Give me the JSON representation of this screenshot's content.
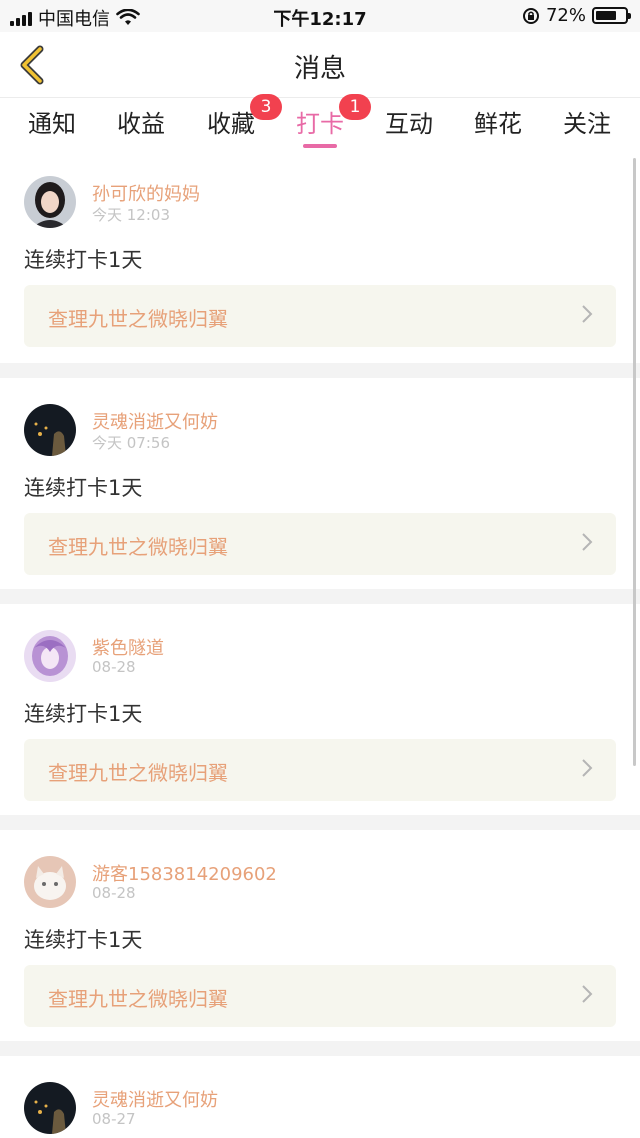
{
  "status_bar": {
    "carrier": "中国电信",
    "time": "下午12:17",
    "battery": "72%",
    "battery_level": 0.72,
    "icons": [
      "signal-icon",
      "wifi-icon",
      "rotation-lock-icon",
      "battery-icon"
    ]
  },
  "nav": {
    "title": "消息",
    "back_icon": "back-chevron-icon"
  },
  "tabs": [
    {
      "label": "通知",
      "active": false
    },
    {
      "label": "收益",
      "active": false
    },
    {
      "label": "收藏",
      "active": false,
      "badge": "3"
    },
    {
      "label": "打卡",
      "active": true,
      "badge": "1"
    },
    {
      "label": "互动",
      "active": false
    },
    {
      "label": "鲜花",
      "active": false
    },
    {
      "label": "关注",
      "active": false
    }
  ],
  "colors": {
    "accent": "#e86aa6",
    "badge": "#f2414f",
    "name": "#e7a179",
    "link_bg": "#f6f6ee",
    "meta": "#c4c4c4"
  },
  "messages": [
    {
      "name": "孙可欣的妈妈",
      "time": "今天 12:03",
      "text": "连续打卡1天",
      "link": "查理九世之微晓归翼",
      "avatar": "woman-portrait"
    },
    {
      "name": "灵魂消逝又何妨",
      "time": "今天 07:56",
      "text": "连续打卡1天",
      "link": "查理九世之微晓归翼",
      "avatar": "dark-night-scene"
    },
    {
      "name": "紫色隧道",
      "time": "08-28",
      "text": "连续打卡1天",
      "link": "查理九世之微晓归翼",
      "avatar": "purple-anime-girl"
    },
    {
      "name": "游客1583814209602",
      "time": "08-28",
      "text": "连续打卡1天",
      "link": "查理九世之微晓归翼",
      "avatar": "white-kitten"
    },
    {
      "name": "灵魂消逝又何妨",
      "time": "08-27",
      "text": "",
      "link": "",
      "avatar": "dark-night-scene"
    }
  ]
}
